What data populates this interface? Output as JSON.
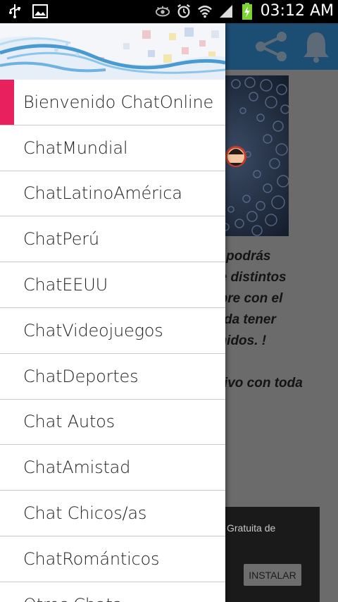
{
  "status_bar": {
    "time": "03:12 AM",
    "icons": [
      "usb-icon",
      "image-icon",
      "eye-icon",
      "alarm-icon",
      "wifi-icon",
      "signal-icon",
      "battery-charging-icon"
    ]
  },
  "app": {
    "toolbar": {
      "bg_color": "#1c4e74",
      "actions": [
        "share-icon",
        "bell-icon"
      ]
    },
    "body_text": [
      "le podrás",
      "de distintos",
      "npre con el",
      "erda tener",
      "enidos. !",
      "",
      "ntivo con toda"
    ],
    "ad": {
      "text": "Gratuita de",
      "button_label": "INSTALAR"
    }
  },
  "drawer": {
    "accent_color": "#e8205e",
    "items": [
      {
        "label": "Bienvenido ChatOnline",
        "active": true
      },
      {
        "label": "ChatMundial"
      },
      {
        "label": "ChatLatinoAmérica"
      },
      {
        "label": "ChatPerú"
      },
      {
        "label": "ChatEEUU"
      },
      {
        "label": "ChatVideojuegos"
      },
      {
        "label": "ChatDeportes"
      },
      {
        "label": "Chat Autos"
      },
      {
        "label": "ChatAmistad"
      },
      {
        "label": "Chat Chicos/as"
      },
      {
        "label": "ChatRománticos"
      },
      {
        "label": "Otros Chats"
      }
    ]
  }
}
